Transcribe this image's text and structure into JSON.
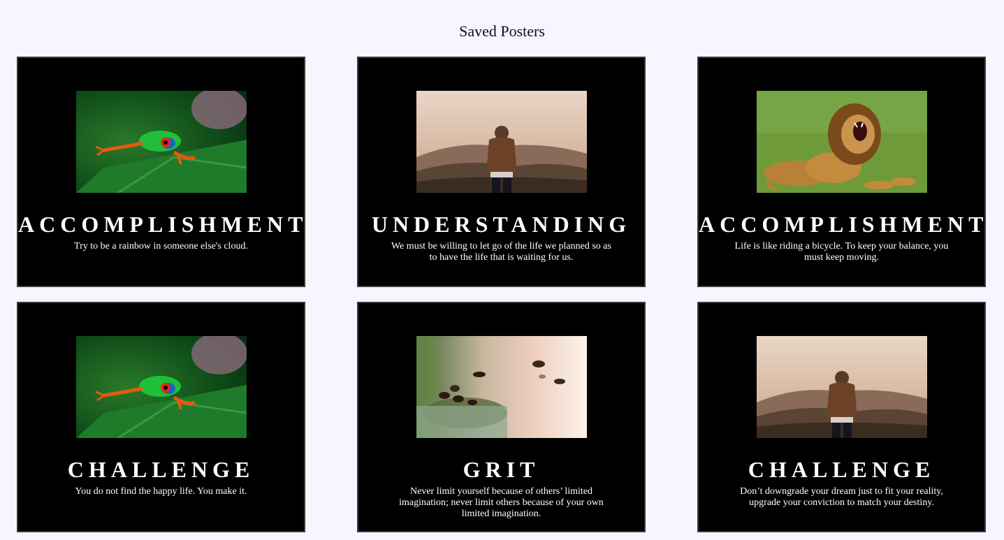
{
  "page": {
    "title": "Saved Posters"
  },
  "posters": [
    {
      "image": "frog-photo",
      "title": "ACCOMPLISHMENT",
      "quote": "Try to be a rainbow in someone else's cloud."
    },
    {
      "image": "hooded-man-on-hills-photo",
      "title": "UNDERSTANDING",
      "quote": "We must be willing to let go of the life we planned so as to have the life that is waiting for us."
    },
    {
      "image": "roaring-lion-photo",
      "title": "ACCOMPLISHMENT",
      "quote": "Life is like riding a bicycle. To keep your balance, you must keep moving."
    },
    {
      "image": "frog-photo",
      "title": "CHALLENGE",
      "quote": "You do not find the happy life. You make it."
    },
    {
      "image": "bees-photo",
      "title": "GRIT",
      "quote": "Never limit yourself because of others’ limited imagination; never limit others because of your own limited imagination."
    },
    {
      "image": "hooded-man-on-hills-photo",
      "title": "CHALLENGE",
      "quote": "Don’t downgrade your dream just to fit your reality, upgrade your conviction to match your destiny."
    }
  ],
  "colors": {
    "page_background": "#f7f5ff",
    "poster_background": "#000000",
    "poster_text": "#ffffff"
  }
}
